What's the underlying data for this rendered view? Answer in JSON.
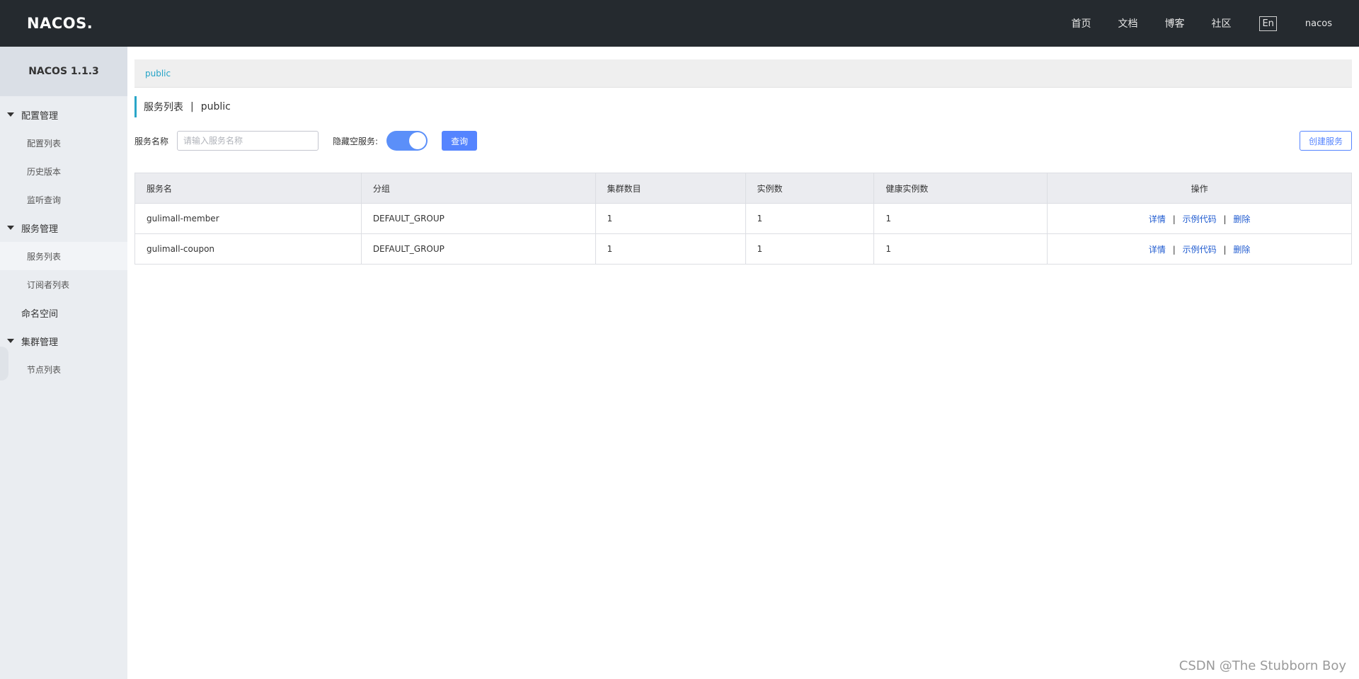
{
  "header": {
    "logo": "NACOS.",
    "nav": [
      "首页",
      "文档",
      "博客",
      "社区"
    ],
    "lang": "En",
    "user": "nacos"
  },
  "sidebar": {
    "title": "NACOS 1.1.3",
    "groups": [
      {
        "label": "配置管理",
        "items": [
          "配置列表",
          "历史版本",
          "监听查询"
        ]
      },
      {
        "label": "服务管理",
        "items": [
          "服务列表",
          "订阅者列表"
        ]
      },
      {
        "label": "命名空间",
        "items": []
      },
      {
        "label": "集群管理",
        "items": [
          "节点列表"
        ]
      }
    ],
    "active_item": "服务列表"
  },
  "breadcrumb": {
    "namespace": "public"
  },
  "page_title": {
    "label": "服务列表",
    "separator": "|",
    "namespace": "public"
  },
  "toolbar": {
    "service_name_label": "服务名称",
    "service_name_placeholder": "请输入服务名称",
    "service_name_value": "",
    "hide_empty_label": "隐藏空服务:",
    "hide_empty_on": true,
    "query_label": "查询",
    "create_label": "创建服务"
  },
  "table": {
    "columns": [
      "服务名",
      "分组",
      "集群数目",
      "实例数",
      "健康实例数",
      "操作"
    ],
    "rows": [
      {
        "name": "gulimall-member",
        "group": "DEFAULT_GROUP",
        "clusters": "1",
        "instances": "1",
        "healthy": "1"
      },
      {
        "name": "gulimall-coupon",
        "group": "DEFAULT_GROUP",
        "clusters": "1",
        "instances": "1",
        "healthy": "1"
      }
    ],
    "ops": {
      "detail": "详情",
      "sample": "示例代码",
      "delete": "删除",
      "sep": "|"
    }
  },
  "watermark": "CSDN @The Stubborn Boy",
  "colors": {
    "header_bg": "#252a2f",
    "sidebar_bg": "#eaedf1",
    "primary": "#5584ff",
    "accent": "#2aa6c8"
  }
}
